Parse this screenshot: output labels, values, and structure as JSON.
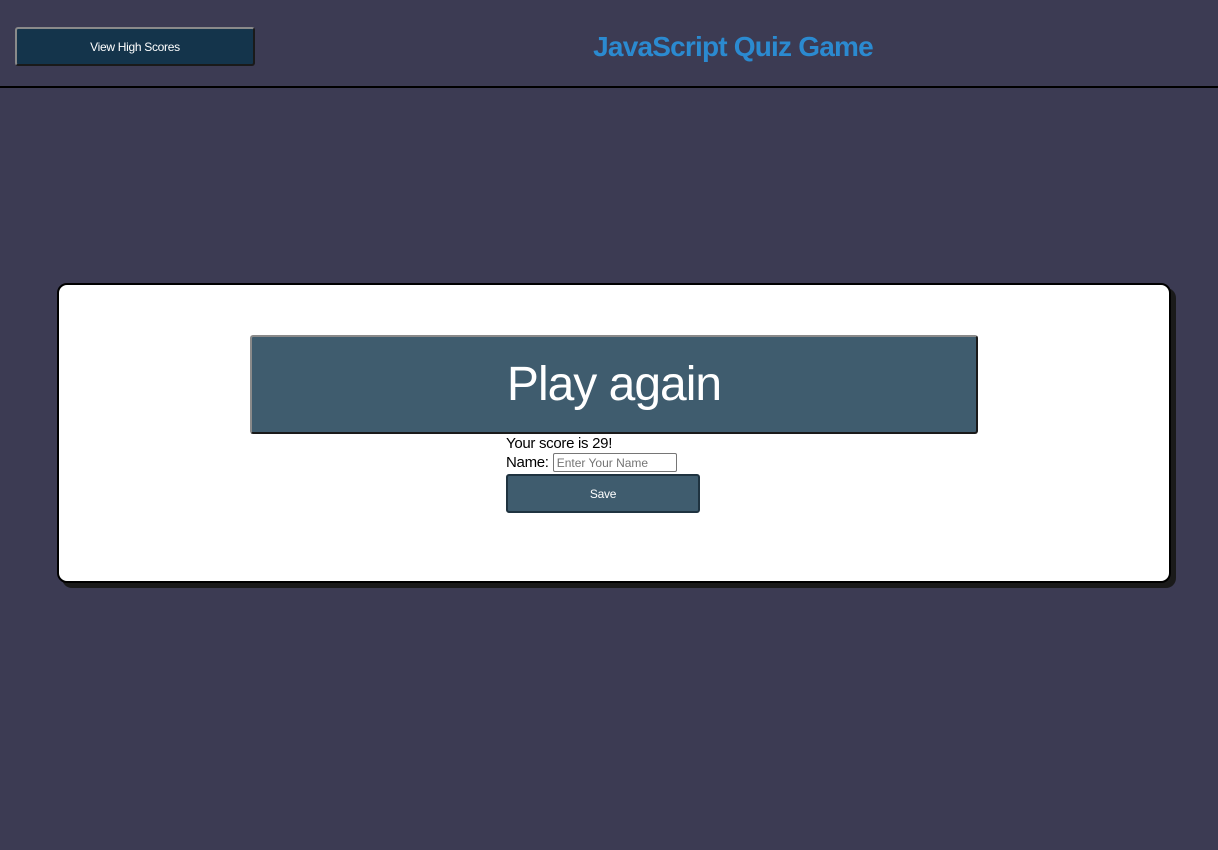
{
  "header": {
    "high_scores_label": "View High Scores",
    "title": "JavaScript Quiz Game"
  },
  "result": {
    "play_again_label": "Play again",
    "score_text": "Your score is 29!",
    "name_label": "Name:",
    "name_value": "",
    "name_placeholder": "Enter Your Name",
    "save_label": "Save"
  },
  "colors": {
    "background": "#3c3b53",
    "title": "#2b8ad0",
    "header_button": "#14344b",
    "action_button": "#3f5c6e",
    "card": "#ffffff"
  }
}
